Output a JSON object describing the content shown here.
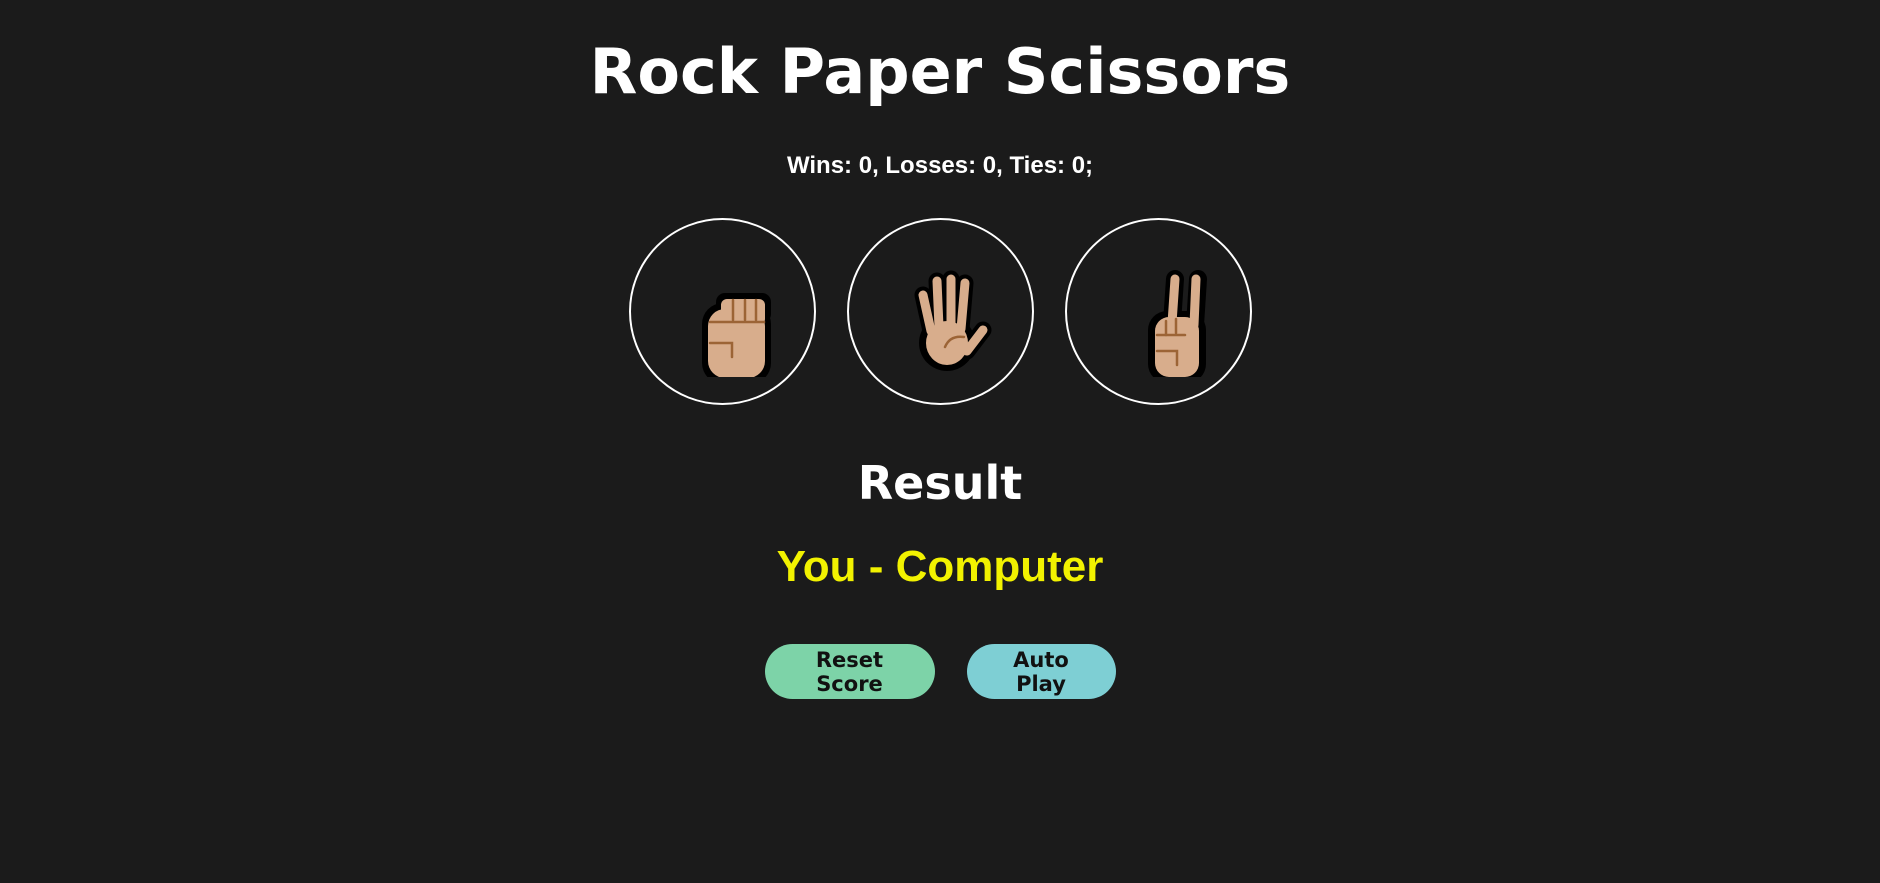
{
  "page": {
    "title": "Rock Paper Scissors",
    "score_text": "Wins: 0, Losses: 0, Ties: 0;",
    "result_heading": "Result",
    "result_text": "You - Computer"
  },
  "moves": [
    {
      "name": "rock",
      "icon": "raised-fist-icon"
    },
    {
      "name": "paper",
      "icon": "raised-hand-icon"
    },
    {
      "name": "scissors",
      "icon": "victory-hand-icon"
    }
  ],
  "actions": {
    "reset_label": "Reset Score",
    "auto_play_label": "Auto Play"
  },
  "colors": {
    "background": "#1b1b1b",
    "text": "#ffffff",
    "result_text": "#f2f200",
    "reset_button": "#7dd3a8",
    "auto_play_button": "#7ecfd4",
    "skin": "#d8ad8c",
    "skin_line": "#9c6436"
  }
}
